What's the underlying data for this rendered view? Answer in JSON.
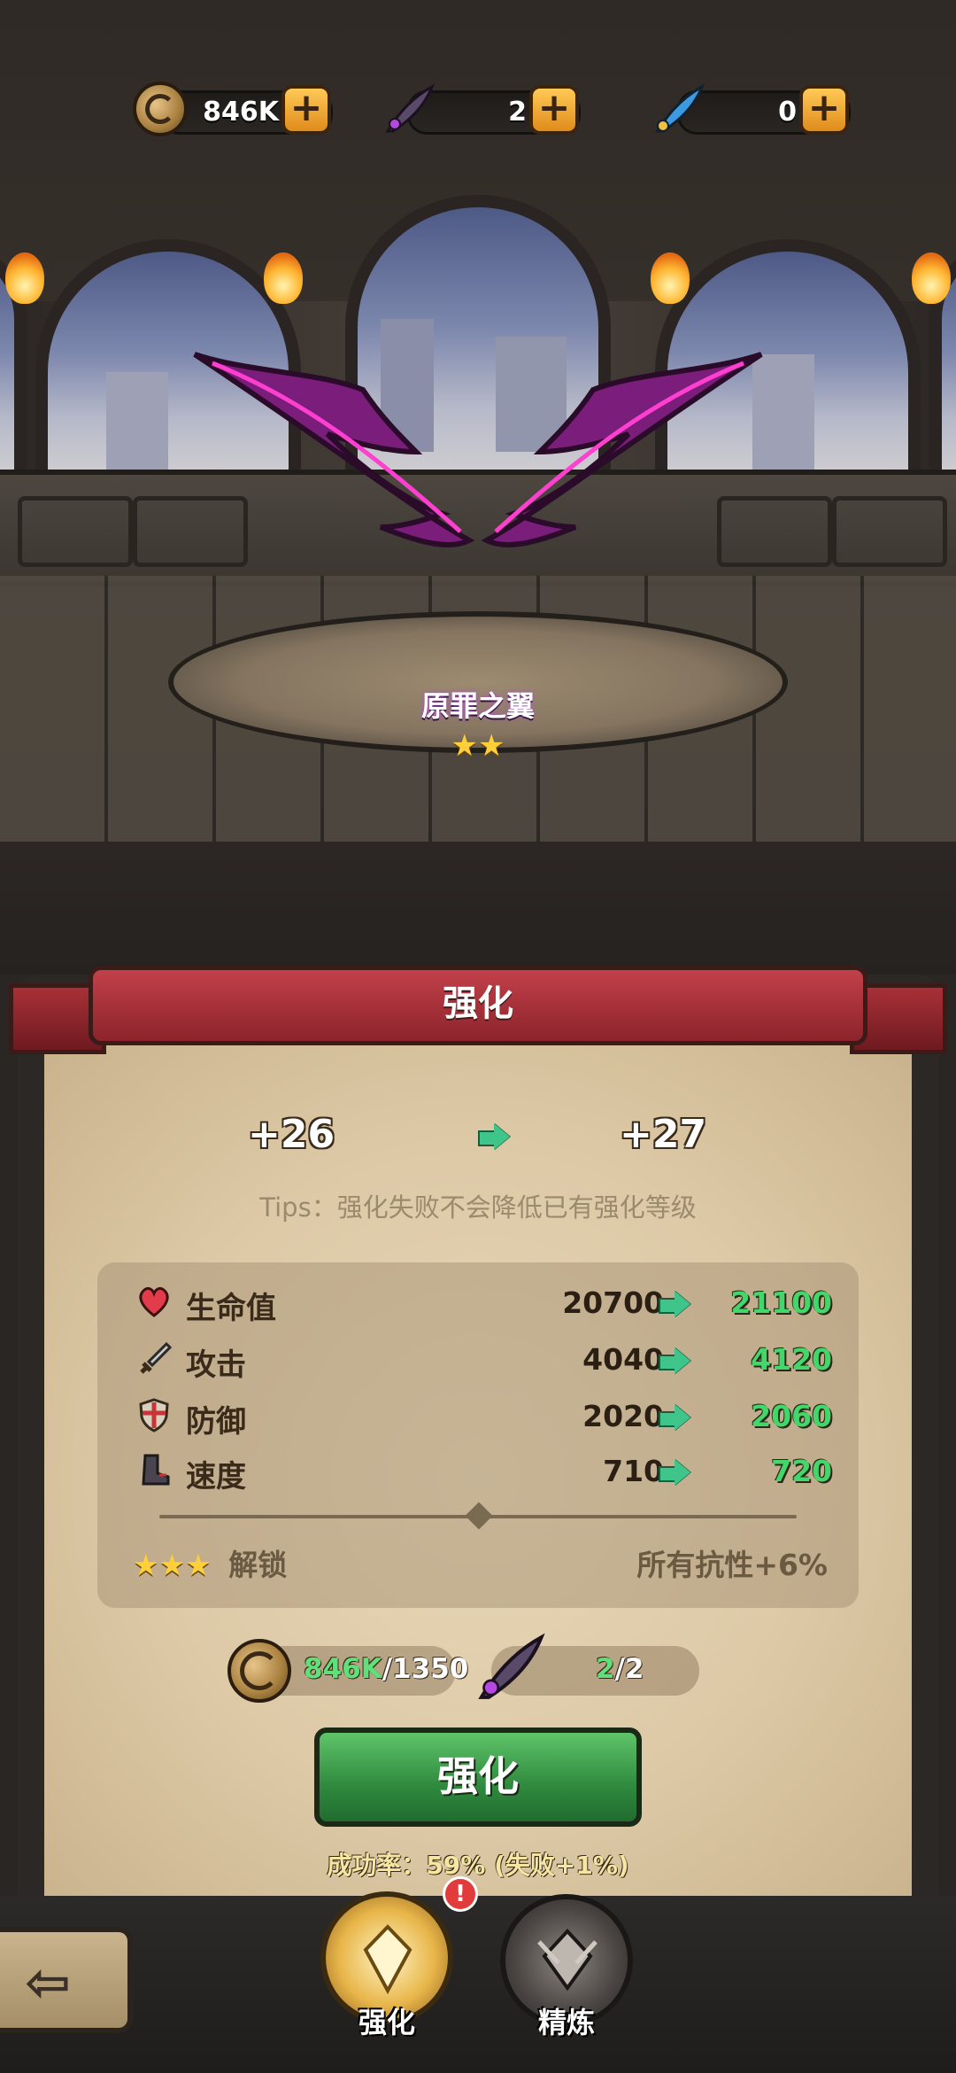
{
  "currency": [
    {
      "icon": "gold-coin-icon",
      "value": "846K",
      "plus": "+"
    },
    {
      "icon": "purple-feather-icon",
      "value": "2",
      "plus": "+"
    },
    {
      "icon": "blue-feather-icon",
      "value": "0",
      "plus": "+"
    }
  ],
  "item": {
    "name": "原罪之翼",
    "stars": "★★"
  },
  "panel": {
    "title": "强化",
    "current_level": "+26",
    "next_level": "+27",
    "tips": "Tips：强化失败不会降低已有强化等级",
    "stats": [
      {
        "icon": "heart-icon",
        "name": "生命值",
        "current": "20700",
        "next": "21100"
      },
      {
        "icon": "sword-icon",
        "name": "攻击",
        "current": "4040",
        "next": "4120"
      },
      {
        "icon": "shield-icon",
        "name": "防御",
        "current": "2020",
        "next": "2060"
      },
      {
        "icon": "boot-icon",
        "name": "速度",
        "current": "710",
        "next": "720"
      }
    ],
    "unlock_stars": "★★★",
    "unlock_label": "解锁",
    "unlock_bonus": "所有抗性+6%",
    "cost_gold_have": "846K",
    "cost_gold_need": "/1350",
    "cost_feather_have": "2",
    "cost_feather_need": "/2",
    "enhance_button": "强化",
    "success_rate": "成功率：59% (失败+1%)"
  },
  "nav": {
    "back": "⇦",
    "tab_enhance": "强化",
    "tab_refine": "精炼",
    "badge": "!"
  },
  "colors": {
    "accent_green": "#43d66a",
    "ribbon_red": "#8c232b",
    "button_green": "#2f8a3f"
  }
}
